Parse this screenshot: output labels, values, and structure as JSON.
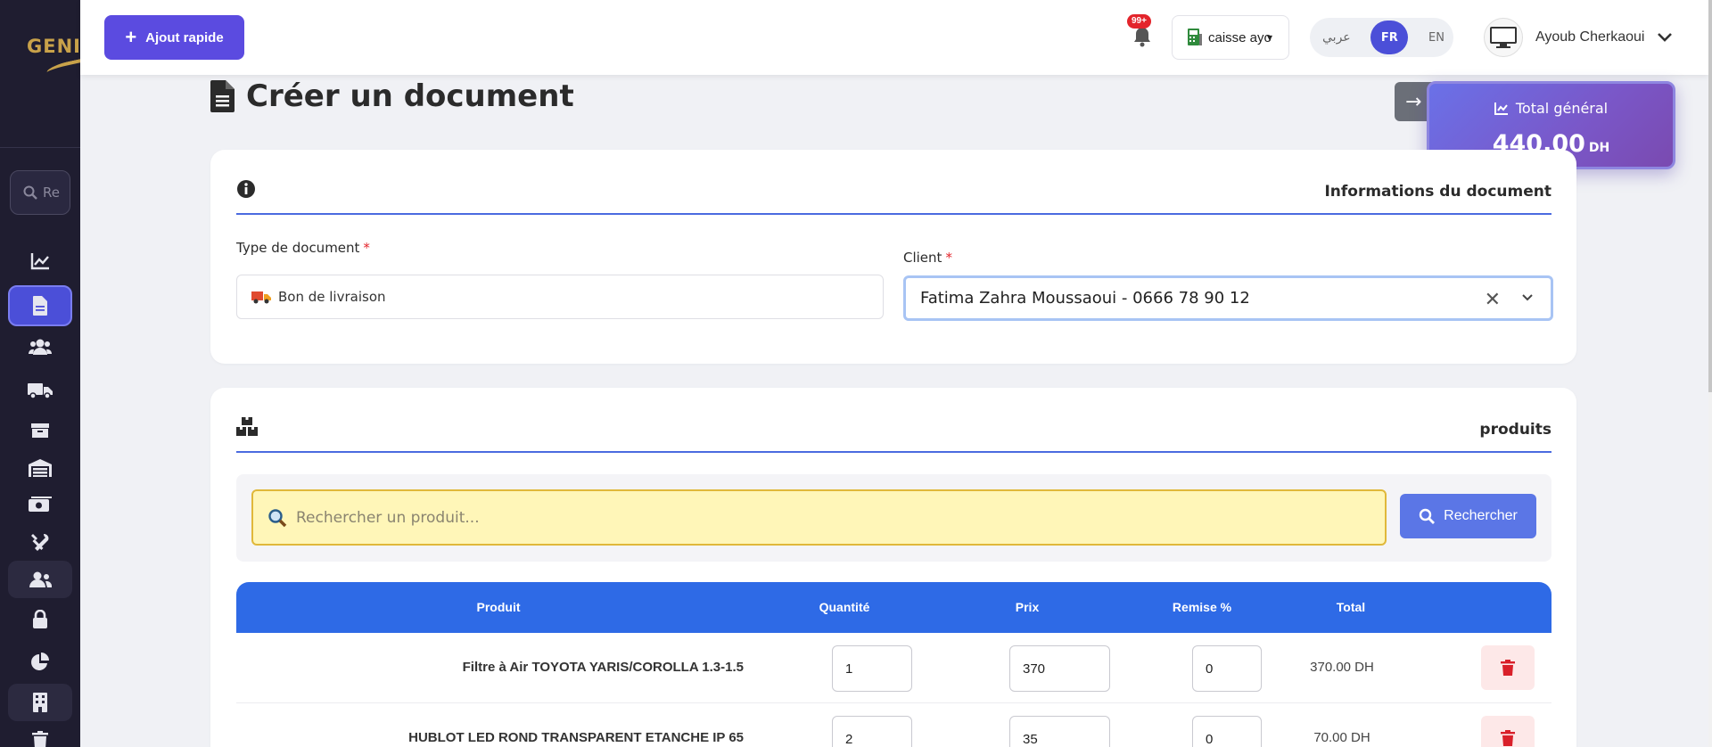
{
  "sidebar": {
    "logo_text": "GENIS",
    "search_placeholder": "Re",
    "items": [
      {
        "icon": "chart-line-icon"
      },
      {
        "icon": "document-icon",
        "active": true
      },
      {
        "icon": "users-icon"
      },
      {
        "icon": "truck-icon"
      },
      {
        "icon": "box-icon"
      },
      {
        "icon": "warehouse-icon"
      },
      {
        "icon": "money-icon"
      },
      {
        "icon": "tools-icon"
      },
      {
        "icon": "user-group-icon"
      },
      {
        "icon": "lock-icon"
      },
      {
        "icon": "pie-chart-icon"
      },
      {
        "icon": "building-icon"
      },
      {
        "icon": "trash-icon"
      }
    ]
  },
  "topbar": {
    "quick_add_label": "Ajout rapide",
    "notification_badge": "99+",
    "caisse_label": "caisse ayo",
    "lang_ar": "عربي",
    "lang_fr": "FR",
    "lang_en": "EN",
    "user_name": "Ayoub Cherkaoui"
  },
  "page": {
    "title": "Créer un document",
    "total_label": "Total général",
    "total_value": "440.00",
    "total_currency": "DH"
  },
  "doc_info": {
    "section_title": "Informations du document",
    "type_label": "Type de document",
    "type_value": "Bon de livraison",
    "client_label": "Client",
    "client_value": "Fatima Zahra Moussaoui - 0666 78 90 12",
    "required_mark": "*"
  },
  "products": {
    "section_title": "produits",
    "search_placeholder": "Rechercher un produit...",
    "search_button": "Rechercher",
    "columns": [
      "Produit",
      "Quantité",
      "Prix",
      "Remise %",
      "Total"
    ],
    "rows": [
      {
        "name": "Filtre à Air TOYOTA YARIS/COROLLA 1.3-1.5",
        "qty": "1",
        "price": "370",
        "discount": "0",
        "total": "370.00 DH"
      },
      {
        "name": "HUBLOT LED ROND TRANSPARENT ETANCHE IP 65",
        "qty": "2",
        "price": "35",
        "discount": "0",
        "total": "70.00 DH"
      }
    ]
  },
  "colors": {
    "sidebar_bg": "#1f1d30",
    "primary": "#5b4be0",
    "table_header": "#2e6ae6",
    "danger": "#e3242b"
  }
}
